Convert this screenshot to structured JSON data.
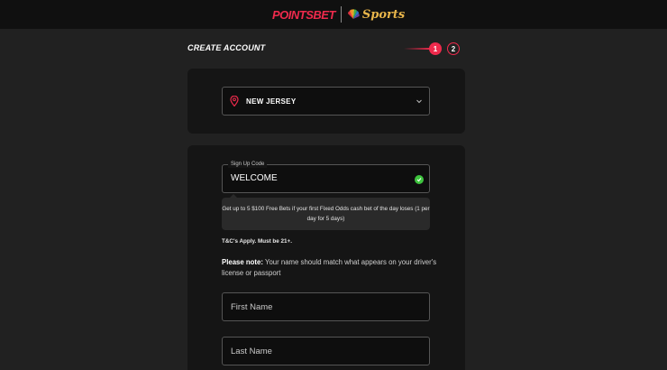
{
  "header": {
    "brand_primary": "POINTSBET",
    "brand_secondary": "Sports",
    "colors": {
      "brand_red": "#ee2a4c",
      "sports_gold": "#e8b54a"
    }
  },
  "page": {
    "title": "CREATE ACCOUNT",
    "steps": [
      "1",
      "2"
    ],
    "active_step": "1"
  },
  "state_select": {
    "icon": "location-pin-icon",
    "value": "NEW JERSEY"
  },
  "signup_code": {
    "label": "Sign Up Code",
    "value": "WELCOME",
    "status_icon": "check-circle-icon",
    "status_color": "#3ec43e"
  },
  "promo": {
    "text": "Get up to 5 $100 Free Bets if your first Fixed Odds cash bet of the day loses (1 per day for 5 days)"
  },
  "terms": "T&C's Apply. Must be 21+.",
  "note": {
    "label": "Please note:",
    "text": " Your name should match what appears on your driver's license or passport"
  },
  "fields": {
    "first_name_placeholder": "First Name",
    "last_name_placeholder": "Last Name"
  }
}
